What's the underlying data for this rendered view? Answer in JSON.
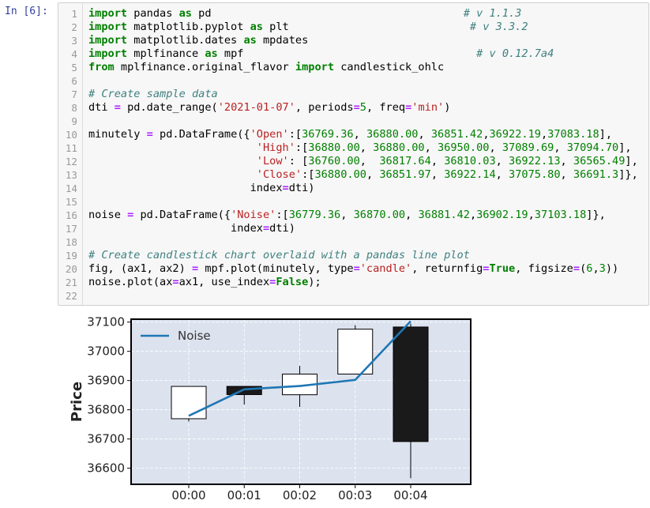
{
  "cell": {
    "prompt": "In [6]:",
    "lines": [
      [
        [
          "kw",
          "import"
        ],
        [
          "plain",
          " pandas "
        ],
        [
          "kw",
          "as"
        ],
        [
          "plain",
          " pd                                       "
        ],
        [
          "com",
          "# v 1.1.3"
        ]
      ],
      [
        [
          "kw",
          "import"
        ],
        [
          "plain",
          " matplotlib.pyplot "
        ],
        [
          "kw",
          "as"
        ],
        [
          "plain",
          " plt                            "
        ],
        [
          "com",
          "# v 3.3.2"
        ]
      ],
      [
        [
          "kw",
          "import"
        ],
        [
          "plain",
          " matplotlib.dates "
        ],
        [
          "kw",
          "as"
        ],
        [
          "plain",
          " mpdates"
        ]
      ],
      [
        [
          "kw",
          "import"
        ],
        [
          "plain",
          " mplfinance "
        ],
        [
          "kw",
          "as"
        ],
        [
          "plain",
          " mpf                                    "
        ],
        [
          "com",
          "# v 0.12.7a4"
        ]
      ],
      [
        [
          "kw",
          "from"
        ],
        [
          "plain",
          " mplfinance.original_flavor "
        ],
        [
          "kw",
          "import"
        ],
        [
          "plain",
          " candlestick_ohlc"
        ]
      ],
      [],
      [
        [
          "com",
          "# Create sample data"
        ]
      ],
      [
        [
          "plain",
          "dti "
        ],
        [
          "op",
          "="
        ],
        [
          "plain",
          " pd.date_range("
        ],
        [
          "str",
          "'2021-01-07'"
        ],
        [
          "plain",
          ", periods"
        ],
        [
          "op",
          "="
        ],
        [
          "num",
          "5"
        ],
        [
          "plain",
          ", freq"
        ],
        [
          "op",
          "="
        ],
        [
          "str",
          "'min'"
        ],
        [
          "plain",
          ")"
        ]
      ],
      [],
      [
        [
          "plain",
          "minutely "
        ],
        [
          "op",
          "="
        ],
        [
          "plain",
          " pd.DataFrame({"
        ],
        [
          "str",
          "'Open'"
        ],
        [
          "plain",
          ":["
        ],
        [
          "num",
          "36769.36"
        ],
        [
          "plain",
          ", "
        ],
        [
          "num",
          "36880.00"
        ],
        [
          "plain",
          ", "
        ],
        [
          "num",
          "36851.42"
        ],
        [
          "plain",
          ","
        ],
        [
          "num",
          "36922.19"
        ],
        [
          "plain",
          ","
        ],
        [
          "num",
          "37083.18"
        ],
        [
          "plain",
          "],"
        ]
      ],
      [
        [
          "plain",
          "                          "
        ],
        [
          "str",
          "'High'"
        ],
        [
          "plain",
          ":["
        ],
        [
          "num",
          "36880.00"
        ],
        [
          "plain",
          ", "
        ],
        [
          "num",
          "36880.00"
        ],
        [
          "plain",
          ", "
        ],
        [
          "num",
          "36950.00"
        ],
        [
          "plain",
          ", "
        ],
        [
          "num",
          "37089.69"
        ],
        [
          "plain",
          ", "
        ],
        [
          "num",
          "37094.70"
        ],
        [
          "plain",
          "],"
        ]
      ],
      [
        [
          "plain",
          "                          "
        ],
        [
          "str",
          "'Low'"
        ],
        [
          "plain",
          ": ["
        ],
        [
          "num",
          "36760.00"
        ],
        [
          "plain",
          ",  "
        ],
        [
          "num",
          "36817.64"
        ],
        [
          "plain",
          ", "
        ],
        [
          "num",
          "36810.03"
        ],
        [
          "plain",
          ", "
        ],
        [
          "num",
          "36922.13"
        ],
        [
          "plain",
          ", "
        ],
        [
          "num",
          "36565.49"
        ],
        [
          "plain",
          "],"
        ]
      ],
      [
        [
          "plain",
          "                          "
        ],
        [
          "str",
          "'Close'"
        ],
        [
          "plain",
          ":["
        ],
        [
          "num",
          "36880.00"
        ],
        [
          "plain",
          ", "
        ],
        [
          "num",
          "36851.97"
        ],
        [
          "plain",
          ", "
        ],
        [
          "num",
          "36922.14"
        ],
        [
          "plain",
          ", "
        ],
        [
          "num",
          "37075.80"
        ],
        [
          "plain",
          ", "
        ],
        [
          "num",
          "36691.3"
        ],
        [
          "plain",
          "]},"
        ]
      ],
      [
        [
          "plain",
          "                         index"
        ],
        [
          "op",
          "="
        ],
        [
          "plain",
          "dti)"
        ]
      ],
      [],
      [
        [
          "plain",
          "noise "
        ],
        [
          "op",
          "="
        ],
        [
          "plain",
          " pd.DataFrame({"
        ],
        [
          "str",
          "'Noise'"
        ],
        [
          "plain",
          ":["
        ],
        [
          "num",
          "36779.36"
        ],
        [
          "plain",
          ", "
        ],
        [
          "num",
          "36870.00"
        ],
        [
          "plain",
          ", "
        ],
        [
          "num",
          "36881.42"
        ],
        [
          "plain",
          ","
        ],
        [
          "num",
          "36902.19"
        ],
        [
          "plain",
          ","
        ],
        [
          "num",
          "37103.18"
        ],
        [
          "plain",
          "]},"
        ]
      ],
      [
        [
          "plain",
          "                      index"
        ],
        [
          "op",
          "="
        ],
        [
          "plain",
          "dti)"
        ]
      ],
      [],
      [
        [
          "com",
          "# Create candlestick chart overlaid with a pandas line plot"
        ]
      ],
      [
        [
          "plain",
          "fig, (ax1, ax2) "
        ],
        [
          "op",
          "="
        ],
        [
          "plain",
          " mpf.plot(minutely, type"
        ],
        [
          "op",
          "="
        ],
        [
          "str",
          "'candle'"
        ],
        [
          "plain",
          ", returnfig"
        ],
        [
          "op",
          "="
        ],
        [
          "kw",
          "True"
        ],
        [
          "plain",
          ", figsize"
        ],
        [
          "op",
          "="
        ],
        [
          "plain",
          "("
        ],
        [
          "num",
          "6"
        ],
        [
          "plain",
          ","
        ],
        [
          "num",
          "3"
        ],
        [
          "plain",
          "))"
        ]
      ],
      [
        [
          "plain",
          "noise.plot(ax"
        ],
        [
          "op",
          "="
        ],
        [
          "plain",
          "ax1, use_index"
        ],
        [
          "op",
          "="
        ],
        [
          "kw",
          "False"
        ],
        [
          "plain",
          ");"
        ]
      ],
      []
    ]
  },
  "chart_data": {
    "type": "candlestick",
    "categories": [
      "00:00",
      "00:01",
      "00:02",
      "00:03",
      "00:04"
    ],
    "open": [
      36769.36,
      36880.0,
      36851.42,
      36922.19,
      37083.18
    ],
    "high": [
      36880.0,
      36880.0,
      36950.0,
      37089.69,
      37094.7
    ],
    "low": [
      36760.0,
      36817.64,
      36810.03,
      36922.13,
      36565.49
    ],
    "close": [
      36880.0,
      36851.97,
      36922.14,
      37075.8,
      36691.3
    ],
    "series": [
      {
        "name": "Noise",
        "type": "line",
        "color": "#1f77b4",
        "values": [
          36779.36,
          36870.0,
          36881.42,
          36902.19,
          37103.18
        ]
      }
    ],
    "ylabel": "Price",
    "yticks": [
      "36600",
      "36700",
      "36800",
      "36900",
      "37000",
      "37100"
    ],
    "ylim": [
      36545,
      37110
    ],
    "up_color": "#ffffff",
    "down_color": "#1a1a1a",
    "plot_bg": "#dce2ee",
    "grid": true,
    "legend_position": "top-left"
  }
}
